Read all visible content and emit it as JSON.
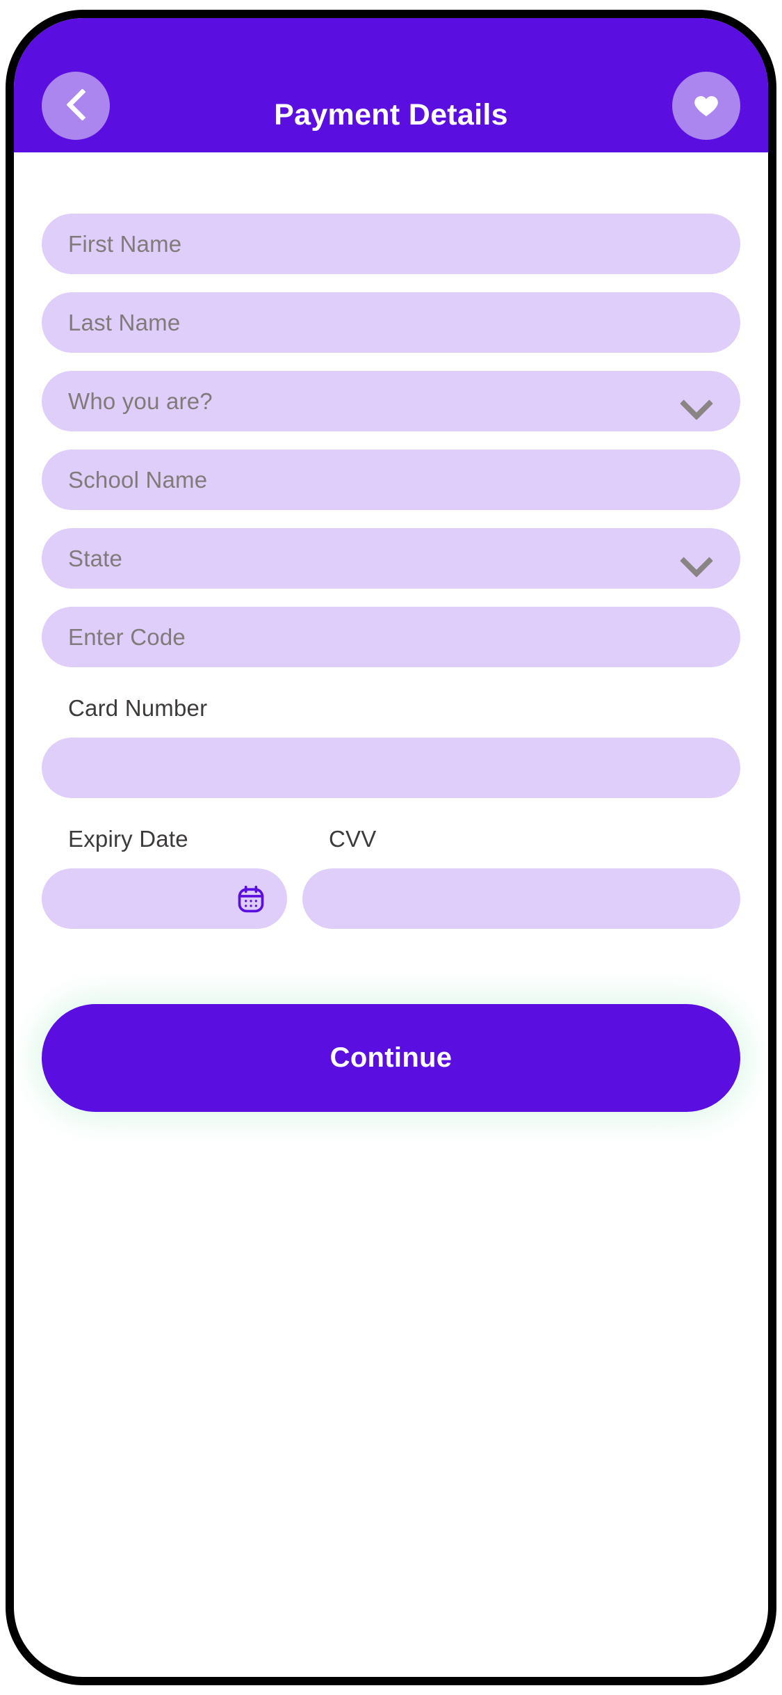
{
  "header": {
    "title": "Payment Details",
    "back_icon": "chevron-left-icon",
    "favorite_icon": "heart-icon",
    "background_color": "#5A0EE0",
    "circle_button_color": "#AB86EE",
    "title_color": "#FFFFFF"
  },
  "theme": {
    "field_background": "#DFCEFA",
    "placeholder_color": "#807B7B",
    "label_color": "#3D3A3A",
    "accent": "#5A0EE0",
    "icon_gray": "#8A8585",
    "page_background": "#FFFFFF",
    "frame_color": "#000000"
  },
  "form": {
    "fields": [
      {
        "name": "first-name",
        "type": "text",
        "placeholder": "First Name",
        "value": ""
      },
      {
        "name": "last-name",
        "type": "text",
        "placeholder": "Last Name",
        "value": ""
      },
      {
        "name": "who-you-are",
        "type": "select",
        "placeholder": "Who you are?",
        "value": "",
        "icon": "chevron-down-icon"
      },
      {
        "name": "school-name",
        "type": "text",
        "placeholder": "School Name",
        "value": ""
      },
      {
        "name": "state",
        "type": "select",
        "placeholder": "State",
        "value": "",
        "icon": "chevron-down-icon"
      },
      {
        "name": "enter-code",
        "type": "text",
        "placeholder": "Enter Code",
        "value": ""
      }
    ],
    "card_number": {
      "label": "Card Number",
      "placeholder": "",
      "value": ""
    },
    "expiry_date": {
      "label": "Expiry Date",
      "placeholder": "",
      "value": "",
      "icon": "calendar-icon"
    },
    "cvv": {
      "label": "CVV",
      "placeholder": "",
      "value": ""
    }
  },
  "actions": {
    "continue_label": "Continue"
  }
}
